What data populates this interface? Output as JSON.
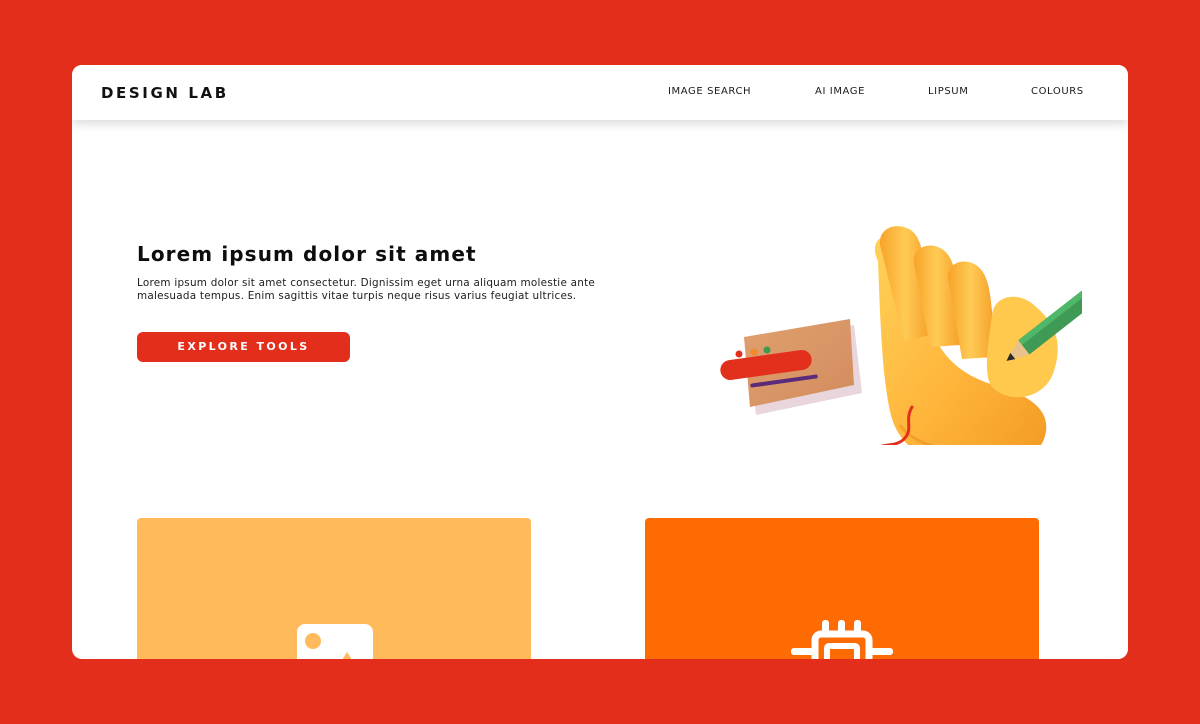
{
  "app": {
    "logo": "DESIGN LAB"
  },
  "nav": {
    "items": [
      {
        "label": "IMAGE SEARCH"
      },
      {
        "label": "AI IMAGE"
      },
      {
        "label": "LIPSUM"
      },
      {
        "label": "COLOURS"
      }
    ]
  },
  "hero": {
    "title": "Lorem ipsum dolor sit amet",
    "text": "Lorem ipsum dolor sit amet consectetur. Dignissim eget urna aliquam molestie ante malesuada tempus. Enim sagittis vitae turpis neque risus varius feugiat ultrices.",
    "cta_label": "EXPLORE TOOLS"
  },
  "cards": [
    {
      "icon": "image-icon",
      "color": "#FFBA5C"
    },
    {
      "icon": "chip-icon",
      "color": "#FF6B03"
    }
  ],
  "colors": {
    "background": "#E42E1C",
    "accent": "#E42E1C",
    "surface": "#FFFFFF"
  }
}
